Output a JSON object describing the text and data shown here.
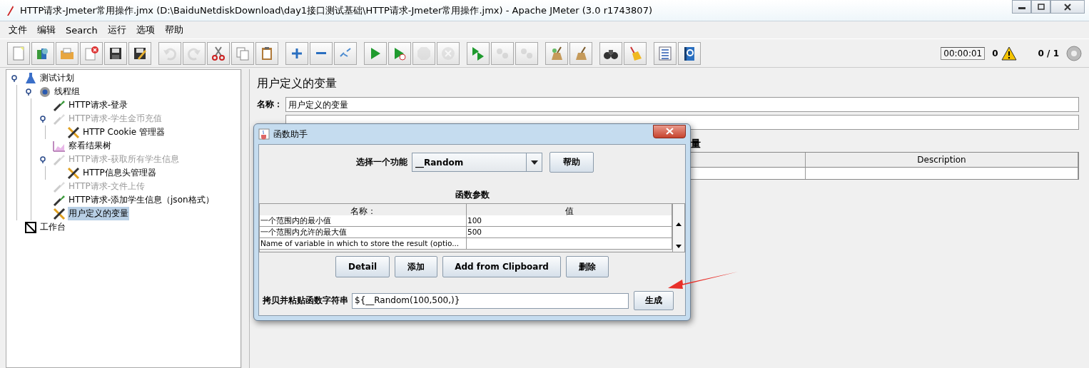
{
  "window": {
    "title": "HTTP请求-Jmeter常用操作.jmx (D:\\BaiduNetdiskDownload\\day1接口测试基础\\HTTP请求-Jmeter常用操作.jmx) - Apache JMeter (3.0 r1743807)"
  },
  "menu": [
    "文件",
    "编辑",
    "Search",
    "运行",
    "选项",
    "帮助"
  ],
  "toolbar": [
    [
      {
        "kind": "new",
        "disabled": false
      },
      {
        "kind": "templates",
        "disabled": false
      },
      {
        "kind": "open",
        "disabled": false
      },
      {
        "kind": "close",
        "disabled": false
      },
      {
        "kind": "save",
        "disabled": false
      },
      {
        "kind": "save-as",
        "disabled": false
      }
    ],
    [
      {
        "kind": "undo",
        "disabled": true
      },
      {
        "kind": "redo",
        "disabled": true
      },
      {
        "kind": "cut",
        "disabled": false
      },
      {
        "kind": "copy",
        "disabled": false
      },
      {
        "kind": "paste",
        "disabled": false
      }
    ],
    [
      {
        "kind": "expand",
        "disabled": false
      },
      {
        "kind": "collapse",
        "disabled": false
      },
      {
        "kind": "toggle",
        "disabled": false
      }
    ],
    [
      {
        "kind": "start",
        "disabled": false
      },
      {
        "kind": "start-no-pause",
        "disabled": false
      },
      {
        "kind": "stop",
        "disabled": true
      },
      {
        "kind": "shutdown",
        "disabled": true
      }
    ],
    [
      {
        "kind": "remote-start",
        "disabled": false
      },
      {
        "kind": "remote-stop",
        "disabled": true
      },
      {
        "kind": "remote-shutdown",
        "disabled": true
      }
    ],
    [
      {
        "kind": "clear",
        "disabled": false
      },
      {
        "kind": "clear-all",
        "disabled": false
      }
    ],
    [
      {
        "kind": "search",
        "disabled": false
      },
      {
        "kind": "reset-search",
        "disabled": false
      }
    ],
    [
      {
        "kind": "function-helper",
        "disabled": false
      },
      {
        "kind": "help",
        "disabled": false
      }
    ]
  ],
  "status": {
    "timer": "00:00:01",
    "warnings": "0",
    "threads": "0 / 1"
  },
  "tree": [
    {
      "label": "测试计划",
      "kind": "test-plan",
      "disabled": false,
      "selected": false,
      "expanded": true,
      "children": [
        {
          "label": "线程组",
          "kind": "thread-group",
          "disabled": false,
          "selected": false,
          "expanded": true,
          "children": [
            {
              "label": "HTTP请求-登录",
              "kind": "sampler",
              "disabled": false,
              "selected": false
            },
            {
              "label": "HTTP请求-学生金币充值",
              "kind": "sampler",
              "disabled": true,
              "selected": false,
              "expanded": true,
              "children": [
                {
                  "label": "HTTP Cookie 管理器",
                  "kind": "config",
                  "disabled": false,
                  "selected": false
                }
              ]
            },
            {
              "label": "察看结果树",
              "kind": "listener",
              "disabled": false,
              "selected": false
            },
            {
              "label": "HTTP请求-获取所有学生信息",
              "kind": "sampler",
              "disabled": true,
              "selected": false,
              "expanded": true,
              "children": [
                {
                  "label": "HTTP信息头管理器",
                  "kind": "config",
                  "disabled": false,
                  "selected": false
                }
              ]
            },
            {
              "label": "HTTP请求-文件上传",
              "kind": "sampler",
              "disabled": true,
              "selected": false
            },
            {
              "label": "HTTP请求-添加学生信息（json格式）",
              "kind": "sampler",
              "disabled": false,
              "selected": false
            },
            {
              "label": "用户定义的变量",
              "kind": "config",
              "disabled": false,
              "selected": true
            }
          ]
        }
      ]
    },
    {
      "label": "工作台",
      "kind": "workbench",
      "disabled": false,
      "selected": false
    }
  ],
  "panel": {
    "title": "用户定义的变量",
    "name_label": "名称：",
    "name_value": "用户定义的变量",
    "table_title": "量",
    "table": {
      "columns": [
        "Description"
      ]
    }
  },
  "dialog": {
    "title": "函数助手",
    "function_label": "选择一个功能",
    "function_value": "__Random",
    "help_button": "帮助",
    "params_title": "函数参数",
    "params_table": {
      "columns": [
        "名称：",
        "值"
      ],
      "rows": [
        {
          "name": "一个范围内的最小值",
          "value": "100"
        },
        {
          "name": "一个范围内允许的最大值",
          "value": "500"
        },
        {
          "name": "Name of variable in which to store the result (optio..."
        }
      ]
    },
    "buttons": [
      "Detail",
      "添加",
      "Add from Clipboard",
      "删除"
    ],
    "result_label": "拷贝并粘贴函数字符串",
    "result_value": "${__Random(100,500,)}",
    "generate_button": "生成"
  }
}
